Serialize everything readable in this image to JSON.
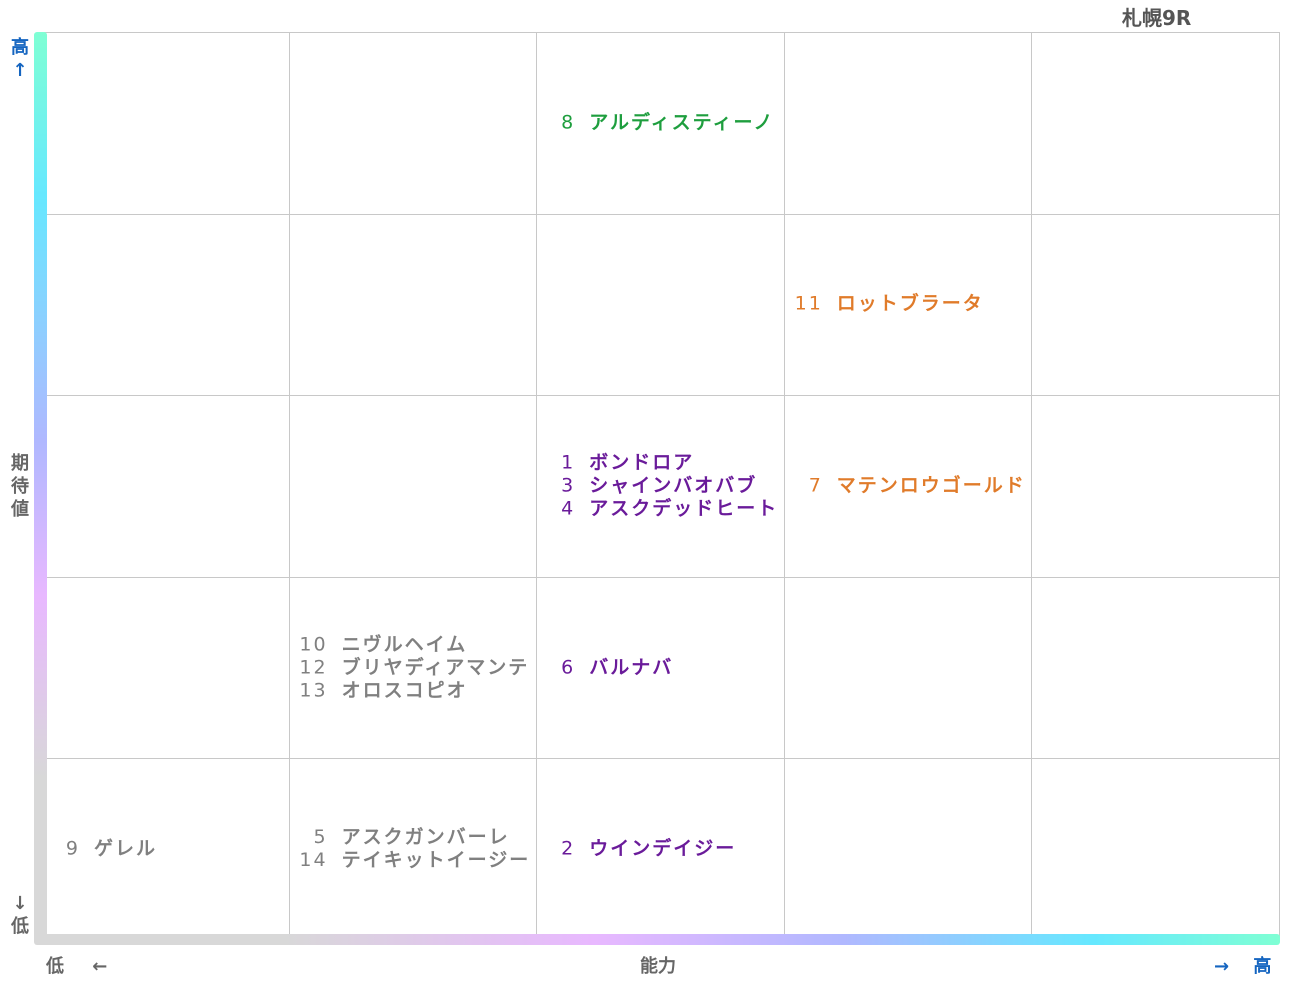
{
  "chart_data": {
    "type": "table",
    "title": "札幌9R",
    "xlabel": "能力",
    "ylabel": "期待値",
    "x_low": "低",
    "x_high": "高",
    "y_low": "低",
    "y_high": "高",
    "arrow_right": "→",
    "arrow_left": "←",
    "arrow_up": "↑",
    "arrow_down": "↓",
    "columns": 5,
    "rows": 5,
    "colors": {
      "green": "#1e9e3e",
      "orange": "#e07b2a",
      "purple": "#6a1b9a",
      "gray": "#808080",
      "axis_label_blue": "#1565c0"
    },
    "cells": [
      {
        "col": 3,
        "row": 5,
        "color": "green",
        "entries": [
          {
            "num": "8",
            "name": "アルディスティーノ"
          }
        ]
      },
      {
        "col": 4,
        "row": 4,
        "color": "orange",
        "entries": [
          {
            "num": "11",
            "name": "ロットブラータ"
          }
        ]
      },
      {
        "col": 3,
        "row": 3,
        "color": "purple",
        "entries": [
          {
            "num": "1",
            "name": "ボンドロア"
          },
          {
            "num": "3",
            "name": "シャインバオバブ"
          },
          {
            "num": "4",
            "name": "アスクデッドヒート"
          }
        ]
      },
      {
        "col": 4,
        "row": 3,
        "color": "orange",
        "entries": [
          {
            "num": "7",
            "name": "マテンロウゴールド"
          }
        ]
      },
      {
        "col": 2,
        "row": 2,
        "color": "gray",
        "entries": [
          {
            "num": "10",
            "name": "ニヴルヘイム"
          },
          {
            "num": "12",
            "name": "ブリヤディアマンテ"
          },
          {
            "num": "13",
            "name": "オロスコピオ"
          }
        ]
      },
      {
        "col": 3,
        "row": 2,
        "color": "purple",
        "entries": [
          {
            "num": "6",
            "name": "バルナバ"
          }
        ]
      },
      {
        "col": 1,
        "row": 1,
        "color": "gray",
        "entries": [
          {
            "num": "9",
            "name": "ゲレル"
          }
        ]
      },
      {
        "col": 2,
        "row": 1,
        "color": "gray",
        "entries": [
          {
            "num": "5",
            "name": "アスクガンバーレ"
          },
          {
            "num": "14",
            "name": "テイキットイージー"
          }
        ]
      },
      {
        "col": 3,
        "row": 1,
        "color": "purple",
        "entries": [
          {
            "num": "2",
            "name": "ウインデイジー"
          }
        ]
      }
    ]
  }
}
